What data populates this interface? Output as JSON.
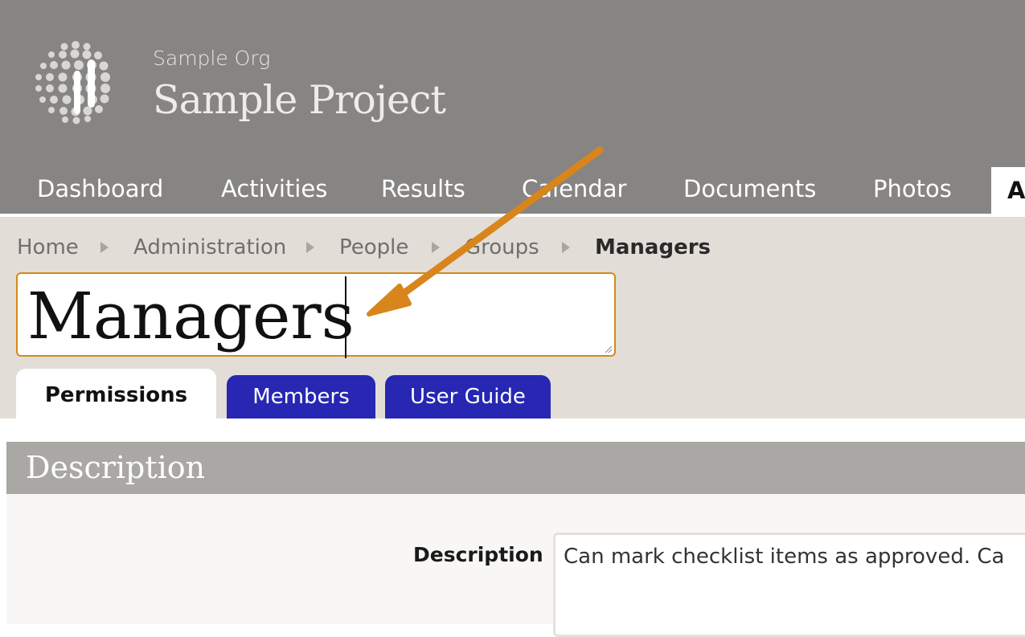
{
  "header": {
    "org_name": "Sample Org",
    "project_name": "Sample Project",
    "logo_icon": "dotted-globe-icon"
  },
  "nav": {
    "items": [
      {
        "label": "Dashboard"
      },
      {
        "label": "Activities"
      },
      {
        "label": "Results"
      },
      {
        "label": "Calendar"
      },
      {
        "label": "Documents"
      },
      {
        "label": "Photos"
      },
      {
        "label": "A"
      }
    ]
  },
  "breadcrumb": {
    "items": [
      {
        "label": "Home"
      },
      {
        "label": "Administration"
      },
      {
        "label": "People"
      },
      {
        "label": "Groups"
      },
      {
        "label": "Managers"
      }
    ]
  },
  "group": {
    "name_value": "Managers"
  },
  "tabs": [
    {
      "label": "Permissions",
      "active": true
    },
    {
      "label": "Members",
      "active": false
    },
    {
      "label": "User Guide",
      "active": false
    }
  ],
  "section": {
    "title": "Description",
    "field_label": "Description",
    "field_value": "Can mark checklist items as approved. Ca"
  },
  "colors": {
    "header_bg": "#878583",
    "content_bg": "#e3ddd7",
    "tab_blue": "#2727b3",
    "focus_orange": "#d48a1a",
    "annotation_arrow": "#d8851c"
  }
}
